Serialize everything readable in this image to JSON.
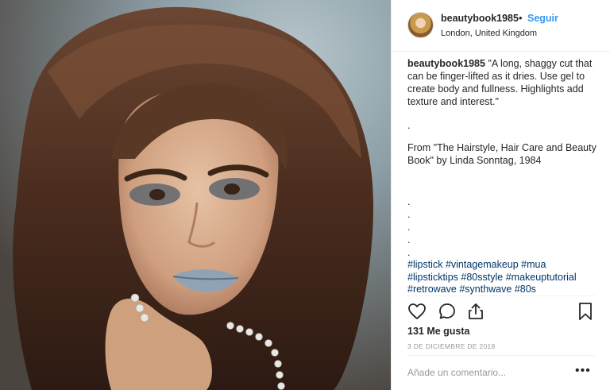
{
  "post": {
    "username": "beautybook1985",
    "separator": "•",
    "follow_label": "Seguir",
    "location": "London, United Kingdom",
    "caption_username": "beautybook1985",
    "caption_text": " \"A long, shaggy cut that can be finger-lifted as it dries. Use gel to create body and fullness. Highlights add texture and interest.\"",
    "dot_lines": [
      ".",
      ".",
      ".",
      ".",
      ".",
      "."
    ],
    "source_text": "From \"The Hairstyle, Hair Care and Beauty Book\" by Linda Sonntag, 1984",
    "hashtags": [
      "#lipstick",
      "#vintagemakeup",
      "#mua",
      "#lipsticktips",
      "#80sstyle",
      "#makeuptutorial",
      "#retrowave",
      "#synthwave",
      "#80s"
    ],
    "likes": "131 Me gusta",
    "date": "3 DE DICIEMBRE DE 2018",
    "comment_placeholder": "Añade un comentario...",
    "more_label": "•••"
  },
  "icons": {
    "like": "heart-icon",
    "comment": "comment-icon",
    "share": "share-icon",
    "save": "bookmark-icon"
  },
  "colors": {
    "link_blue": "#3897f0",
    "hashtag": "#003569",
    "muted": "#999999",
    "text": "#262626"
  }
}
